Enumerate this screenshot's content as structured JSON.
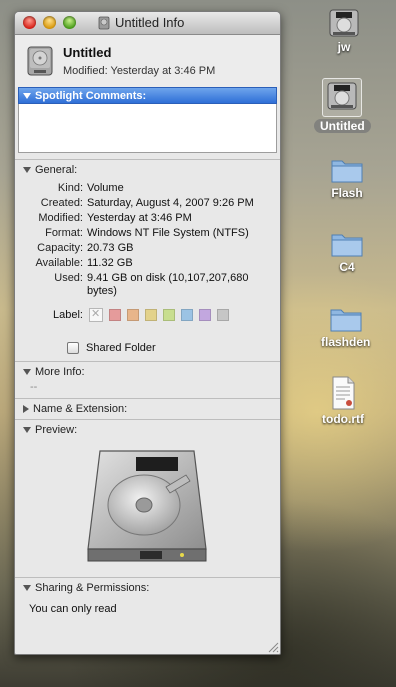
{
  "window": {
    "title": "Untitled Info",
    "name": "Untitled",
    "modified_line": "Modified: Yesterday at 3:46 PM"
  },
  "spotlight": {
    "header": "Spotlight Comments:",
    "value": ""
  },
  "general": {
    "header": "General:",
    "rows": [
      {
        "key": "Kind:",
        "value": "Volume"
      },
      {
        "key": "Created:",
        "value": "Saturday, August 4, 2007 9:26 PM"
      },
      {
        "key": "Modified:",
        "value": "Yesterday at 3:46 PM"
      },
      {
        "key": "Format:",
        "value": "Windows NT File System (NTFS)"
      },
      {
        "key": "Capacity:",
        "value": "20.73 GB"
      },
      {
        "key": "Available:",
        "value": "11.32 GB"
      },
      {
        "key": "Used:",
        "value": "9.41 GB on disk (10,107,207,680 bytes)"
      }
    ],
    "label_key": "Label:",
    "label_colors": [
      "#e59b9b",
      "#e8b58a",
      "#e3d28b",
      "#c8de8f",
      "#9bc3e4",
      "#c2a7df",
      "#c6c6c6"
    ],
    "shared_folder_label": "Shared Folder",
    "shared_folder_checked": false
  },
  "more_info": {
    "header": "More Info:",
    "value": "--"
  },
  "name_ext": {
    "header": "Name & Extension:"
  },
  "preview": {
    "header": "Preview:"
  },
  "sharing": {
    "header": "Sharing & Permissions:",
    "value": "You can only read"
  },
  "desktop": {
    "icons": [
      {
        "label": "jw",
        "type": "drive"
      },
      {
        "label": "Untitled",
        "type": "drive",
        "selected": true
      },
      {
        "label": "Flash",
        "type": "folder"
      },
      {
        "label": "C4",
        "type": "folder"
      },
      {
        "label": "flashden",
        "type": "folder"
      },
      {
        "label": "todo.rtf",
        "type": "document"
      }
    ]
  }
}
